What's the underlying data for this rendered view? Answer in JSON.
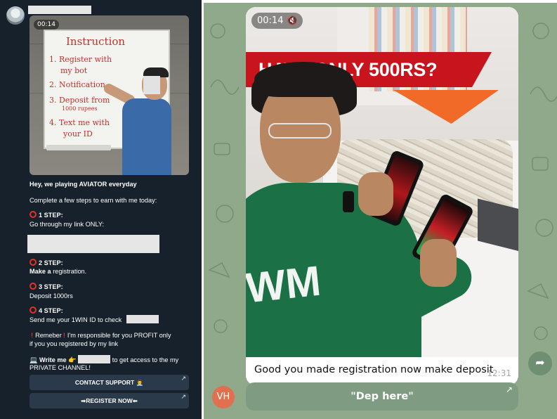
{
  "left_panel": {
    "video_timer": "00:14",
    "board": {
      "title": "Instruction",
      "lines": [
        "1. Register with",
        "my bot",
        "2. Notification",
        "3. Deposit from",
        "1000 rupees",
        "4. Text me with",
        "your ID"
      ]
    },
    "message": {
      "intro": "Hey, we playing AVIATOR everyday",
      "complete": "Complete a few steps to earn with me today:",
      "step1_title": "1 STEP:",
      "step1_text": "Go through my link ONLY:",
      "step2_title": "2 STEP:",
      "step2_bold": "Make a",
      "step2_rest": " registration.",
      "step3_title": "3 STEP:",
      "step3_text": "Deposit 1000rs",
      "step4_title": "4 STEP:",
      "step4_text": "Send me your 1WIN ID to check",
      "warn_a": "Remeber",
      "warn_b": "I'm responsible for you PROFIT only",
      "warn_c": "if you you registered by my link",
      "write_me_bold": "Write me",
      "write_me_rest": " to get access to the my",
      "private_channel": "PRIVATE CHANNEL!"
    },
    "buttons": [
      {
        "label": "CONTACT SUPPORT 👨‍💼"
      },
      {
        "label": "➡REGISTER NOW⬅"
      }
    ]
  },
  "right_panel": {
    "video_timer": "00:14",
    "banner_text": "HAVE ONLY 500RS?",
    "shirt_text": "WM",
    "caption": "Good you made registration now make deposit",
    "time": "12:31",
    "button_label": "\"Dep here\"",
    "avatar_initials": "VH"
  },
  "colors": {
    "dark_bg": "#17212b",
    "button_dark": "#2b3a4a",
    "accent_red": "#e2332b",
    "green_bg": "#8fa98a",
    "banner_red": "#c7141d",
    "avatar_orange": "#e0704f"
  },
  "icons": [
    "mute-icon",
    "share-icon",
    "external-link-arrow-icon",
    "red-circle-icon",
    "exclamation-icon"
  ]
}
